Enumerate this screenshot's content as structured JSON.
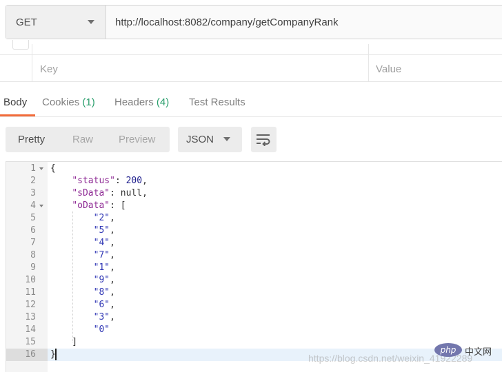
{
  "request": {
    "method": "GET",
    "url": "http://localhost:8082/company/getCompanyRank"
  },
  "params": {
    "key_placeholder": "Key",
    "value_placeholder": "Value"
  },
  "response_tabs": [
    {
      "label": "Body",
      "count": ""
    },
    {
      "label": "Cookies",
      "count": "(1)"
    },
    {
      "label": "Headers",
      "count": "(4)"
    },
    {
      "label": "Test Results",
      "count": ""
    }
  ],
  "toolbar": {
    "view_modes": [
      "Pretty",
      "Raw",
      "Preview"
    ],
    "format": "JSON"
  },
  "code_lines": [
    "{",
    "    \"status\": 200,",
    "    \"sData\": null,",
    "    \"oData\": [",
    "        \"2\",",
    "        \"5\",",
    "        \"4\",",
    "        \"7\",",
    "        \"1\",",
    "        \"9\",",
    "        \"8\",",
    "        \"6\",",
    "        \"3\",",
    "        \"0\"",
    "    ]",
    "}"
  ],
  "line_numbers": [
    "1",
    "2",
    "3",
    "4",
    "5",
    "6",
    "7",
    "8",
    "9",
    "10",
    "11",
    "12",
    "13",
    "14",
    "15",
    "16"
  ],
  "watermark": {
    "text": "https://blog.csdn.net/weixin_41922289",
    "logo": "php",
    "logo_suffix": "中文网"
  },
  "colors": {
    "active_tab_underline": "#f26b3a",
    "count_green": "#2b9f6d",
    "json_key": "#8e2a94",
    "json_string": "#2f36b4"
  }
}
